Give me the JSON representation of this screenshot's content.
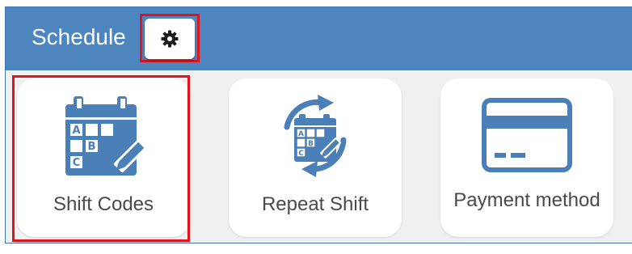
{
  "header": {
    "title": "Schedule",
    "settings_icon": "gear-icon"
  },
  "cards": [
    {
      "label": "Shift Codes",
      "icon": "calendar-grid-edit-icon",
      "grid_letters": [
        "A",
        "B",
        "C"
      ],
      "selected": true
    },
    {
      "label": "Repeat Shift",
      "icon": "calendar-repeat-icon",
      "grid_letters": [
        "A",
        "B",
        "C"
      ],
      "selected": false
    },
    {
      "label": "Payment method",
      "icon": "credit-card-icon",
      "selected": false
    }
  ],
  "colors": {
    "header_bg": "#4d86bf",
    "icon_blue": "#4a7fb8",
    "highlight_red": "#e0141b",
    "panel_bg": "#f0f0f0"
  }
}
